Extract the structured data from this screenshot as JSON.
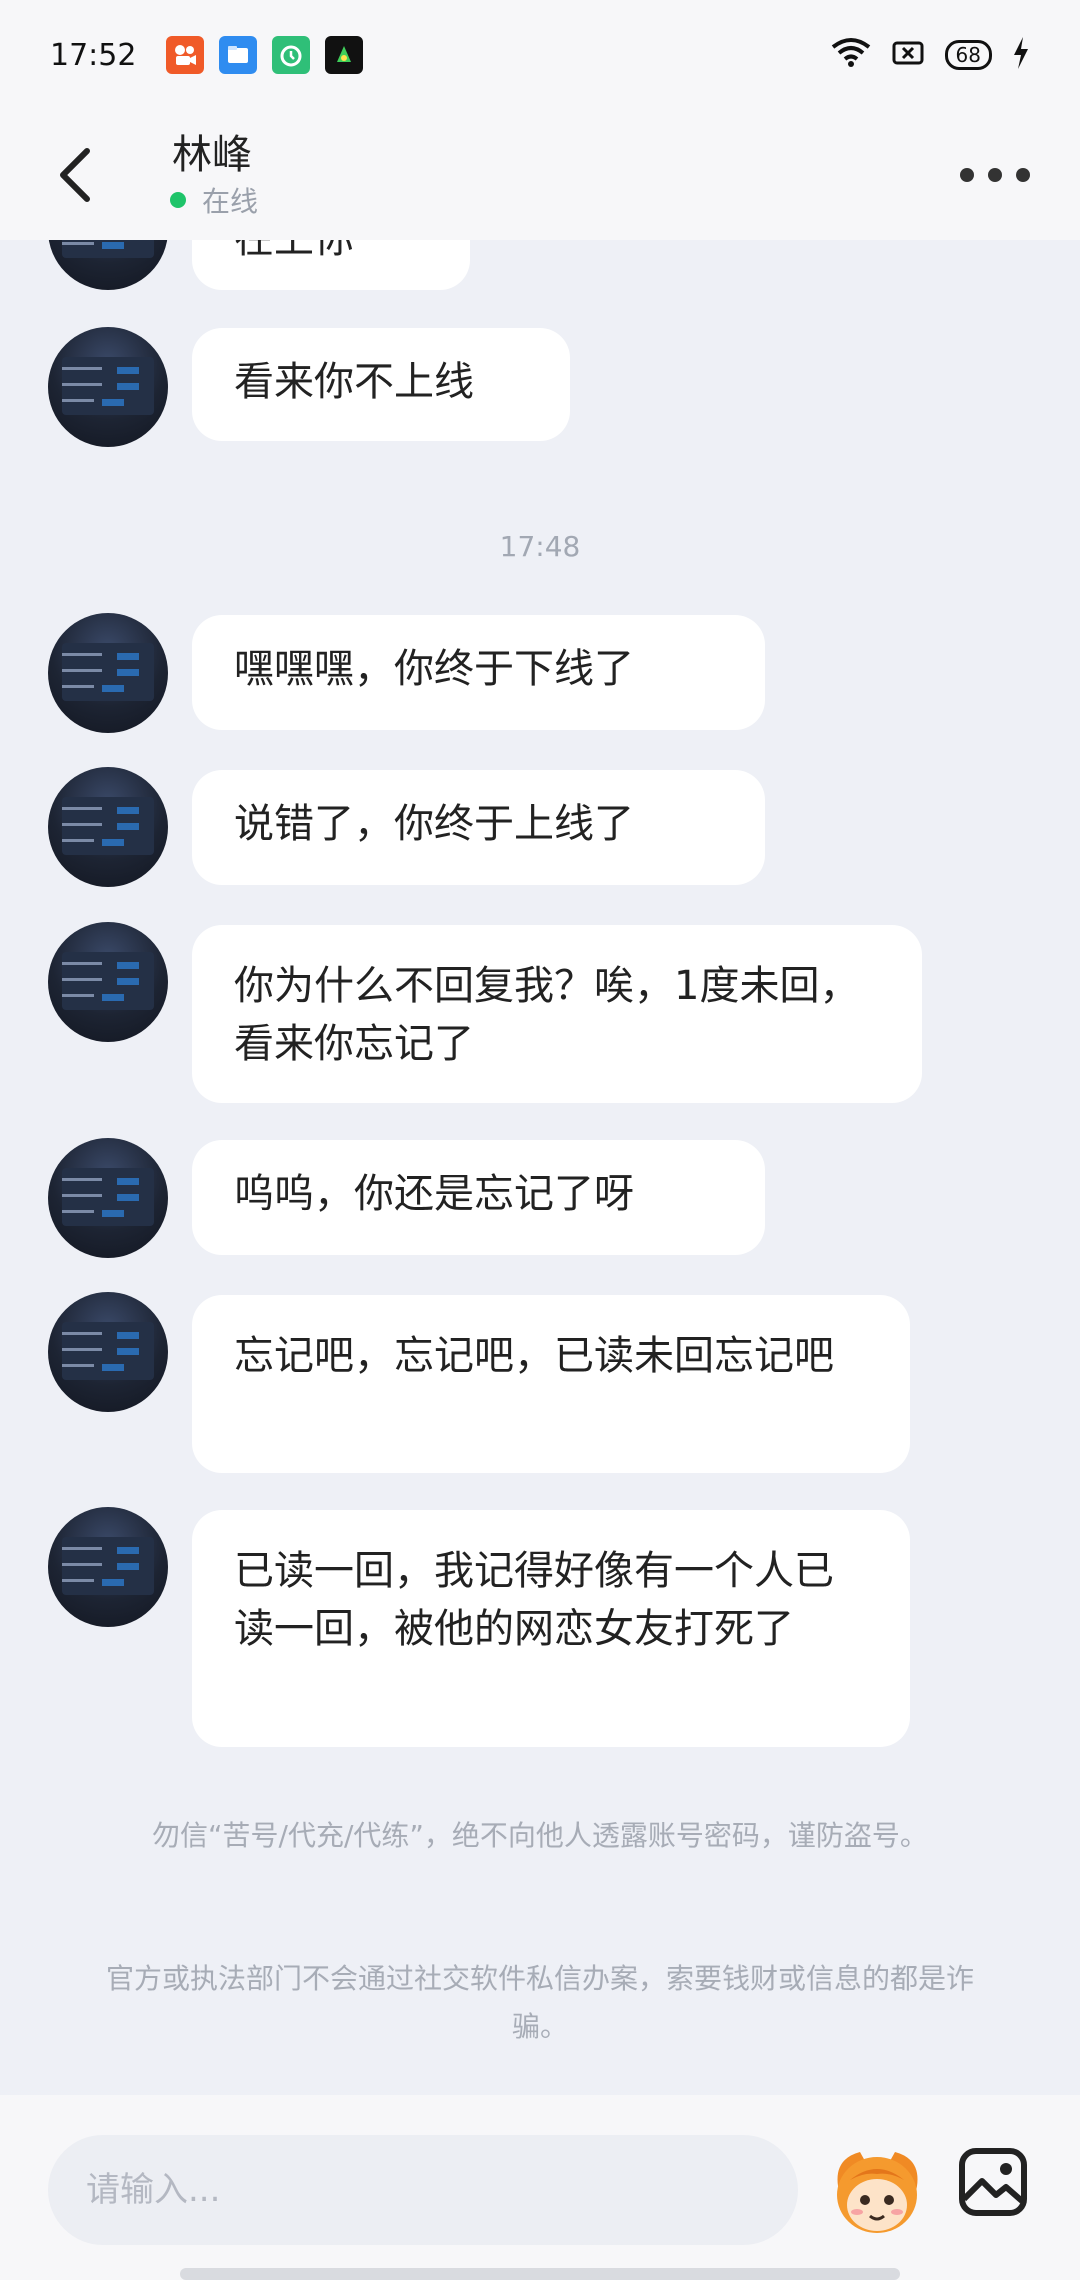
{
  "status_bar": {
    "time": "17:52",
    "battery": "68",
    "app_icons": [
      "kuaishou-icon",
      "files-icon",
      "clock-icon",
      "game-icon"
    ]
  },
  "header": {
    "title": "林峰",
    "status": "在线",
    "status_color": "#1fc46a"
  },
  "chat": {
    "partial_message": "在上你",
    "messages": [
      {
        "text": "看来你不上线"
      },
      {
        "text": "嘿嘿嘿，你终于下线了"
      },
      {
        "text": "说错了，你终于上线了"
      },
      {
        "text": "你为什么不回复我？唉，1度未回，看来你忘记了"
      },
      {
        "text": "呜呜，你还是忘记了呀"
      },
      {
        "text": "忘记吧，忘记吧，已读未回忘记吧"
      },
      {
        "text": "已读一回，我记得好像有一个人已读一回，被他的网恋女友打死了"
      }
    ],
    "timestamp": "17:48",
    "notices": [
      "勿信“苦号/代充/代练”，绝不向他人透露账号密码，谨防盗号。",
      "官方或执法部门不会通过社交软件私信办案，索要钱财或信息的都是诈骗。"
    ]
  },
  "input": {
    "placeholder": "请输入..."
  }
}
